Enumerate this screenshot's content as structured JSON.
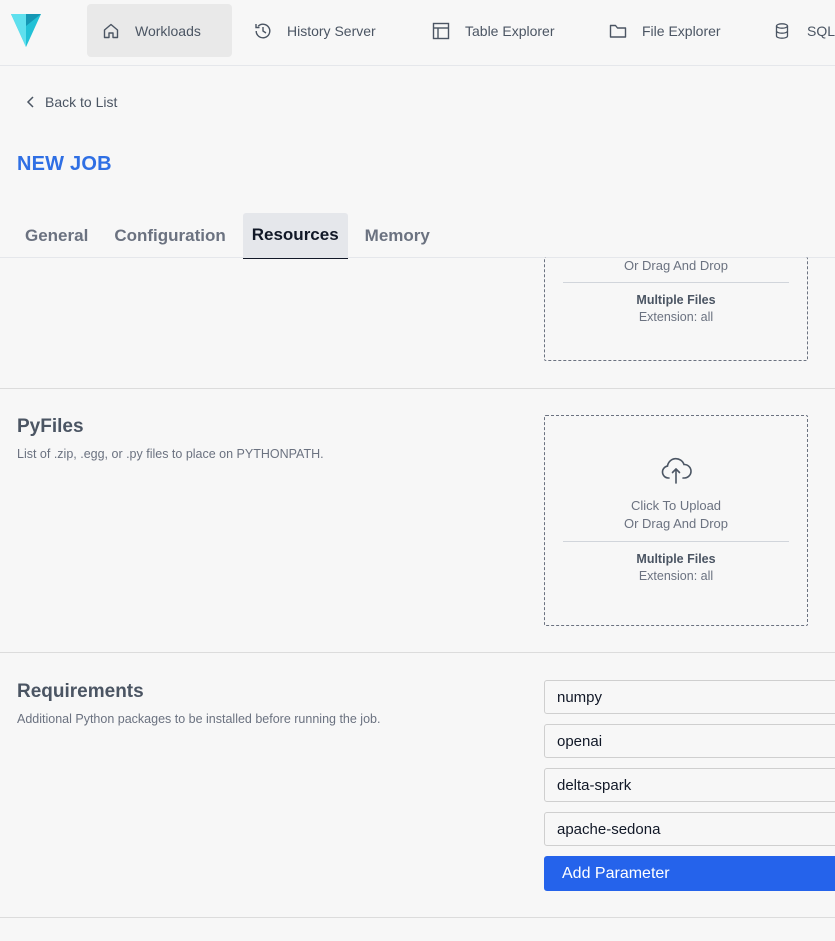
{
  "nav": {
    "items": [
      {
        "label": "Workloads",
        "icon": "home-icon"
      },
      {
        "label": "History Server",
        "icon": "history-icon"
      },
      {
        "label": "Table Explorer",
        "icon": "table-icon"
      },
      {
        "label": "File Explorer",
        "icon": "folder-icon"
      },
      {
        "label": "SQL",
        "icon": "database-icon"
      }
    ]
  },
  "back_label": "Back to List",
  "page_title": "NEW JOB",
  "tabs": [
    {
      "label": "General"
    },
    {
      "label": "Configuration"
    },
    {
      "label": "Resources"
    },
    {
      "label": "Memory"
    }
  ],
  "top_upload": {
    "drag_text": "Or Drag And Drop",
    "multiple": "Multiple Files",
    "extension": "Extension: all"
  },
  "pyfiles": {
    "title": "PyFiles",
    "description": "List of .zip, .egg, or .py files to place on PYTHONPATH.",
    "upload": {
      "click_text": "Click To Upload",
      "drag_text": "Or Drag And Drop",
      "multiple": "Multiple Files",
      "extension": "Extension: all"
    }
  },
  "requirements": {
    "title": "Requirements",
    "description": "Additional Python packages to be installed before running the job.",
    "values": [
      "numpy",
      "openai",
      "delta-spark",
      "apache-sedona"
    ],
    "add_label": "Add Parameter"
  },
  "colors": {
    "accent": "#2563eb",
    "title_blue": "#2f6fe4",
    "logo_cyan": "#22c1d6"
  }
}
